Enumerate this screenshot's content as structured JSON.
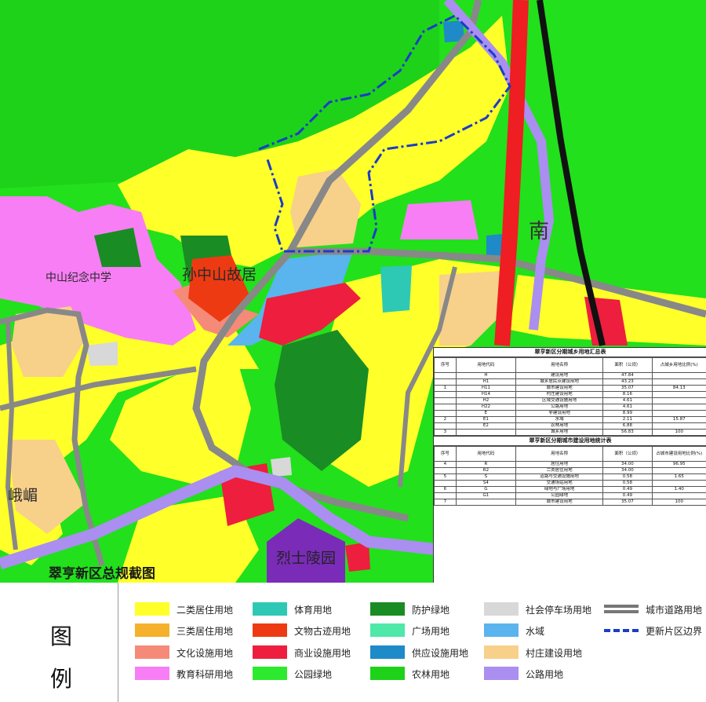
{
  "map": {
    "title": "翠亨新区总规截图",
    "labels": {
      "school": "中山纪念中学",
      "residence": "孙中山故居",
      "nan": "南",
      "mountain": "峨嵋",
      "tomb": "烈士陵园"
    }
  },
  "land_use_table": {
    "title": "翠亨新区分期城乡用地汇总表",
    "headers": [
      "序号",
      "用地代码",
      "用地名称",
      "面积（公顷）",
      "占城乡用地比例(%)"
    ],
    "rows": [
      [
        "",
        "H",
        "建设用地",
        "47.84",
        ""
      ],
      [
        "",
        "H1",
        "城乡居民点建设用地",
        "43.23",
        ""
      ],
      [
        "1",
        "H11",
        "城市建设用地",
        "35.07",
        "84.13"
      ],
      [
        "",
        "H14",
        "村庄建设用地",
        "8.16",
        ""
      ],
      [
        "",
        "H2",
        "区域交通设施用地",
        "4.61",
        ""
      ],
      [
        "",
        "H22",
        "公路用地",
        "4.61",
        ""
      ],
      [
        "",
        "E",
        "非建设用地",
        "8.99",
        ""
      ],
      [
        "2",
        "E1",
        "水域",
        "2.11",
        "15.87"
      ],
      [
        "",
        "E2",
        "农林用地",
        "6.88",
        ""
      ],
      [
        "3",
        "",
        "城乡用地",
        "56.83",
        "100"
      ]
    ]
  },
  "urban_table": {
    "title": "翠亨新区分期城市建设用地统计表",
    "headers": [
      "序号",
      "用地代码",
      "用地名称",
      "面积（公顷）",
      "占城市建设用地比例(%)"
    ],
    "rows": [
      [
        "4",
        "R",
        "居住用地",
        "34.00",
        "96.95"
      ],
      [
        "",
        "R2",
        "二类居住用地",
        "34.00",
        ""
      ],
      [
        "5",
        "S",
        "道路与交通设施用地",
        "0.58",
        "1.65"
      ],
      [
        "",
        "S4",
        "交通场站用地",
        "0.58",
        ""
      ],
      [
        "6",
        "G",
        "绿地与广场用地",
        "0.49",
        "1.40"
      ],
      [
        "",
        "G1",
        "公园绿地",
        "0.49",
        ""
      ],
      [
        "7",
        "",
        "城市建设用地",
        "35.07",
        "100"
      ]
    ]
  },
  "legend": {
    "heading_1": "图",
    "heading_2": "例",
    "items": [
      {
        "label": "二类居住用地",
        "color": "#ffff2a"
      },
      {
        "label": "三类居住用地",
        "color": "#f5b12c"
      },
      {
        "label": "文化设施用地",
        "color": "#f58a78"
      },
      {
        "label": "教育科研用地",
        "color": "#f87ef5"
      },
      {
        "label": "体育用地",
        "color": "#2ec9b4"
      },
      {
        "label": "文物古迹用地",
        "color": "#ee3a12"
      },
      {
        "label": "商业设施用地",
        "color": "#ee1e3e"
      },
      {
        "label": "公园绿地",
        "color": "#2eea2e"
      },
      {
        "label": "防护绿地",
        "color": "#1a8c24"
      },
      {
        "label": "广场用地",
        "color": "#4ee8a8"
      },
      {
        "label": "供应设施用地",
        "color": "#1e8ac8"
      },
      {
        "label": "农林用地",
        "color": "#1ed21a"
      },
      {
        "label": "社会停车场用地",
        "color": "#d8d8d8"
      },
      {
        "label": "水域",
        "color": "#5ab4ee"
      },
      {
        "label": "村庄建设用地",
        "color": "#f7d08a"
      },
      {
        "label": "公路用地",
        "color": "#aa8ef0"
      },
      {
        "label": "城市道路用地",
        "color": "#888888"
      },
      {
        "label": "更新片区边界",
        "color": "#1a3cc8"
      }
    ]
  }
}
